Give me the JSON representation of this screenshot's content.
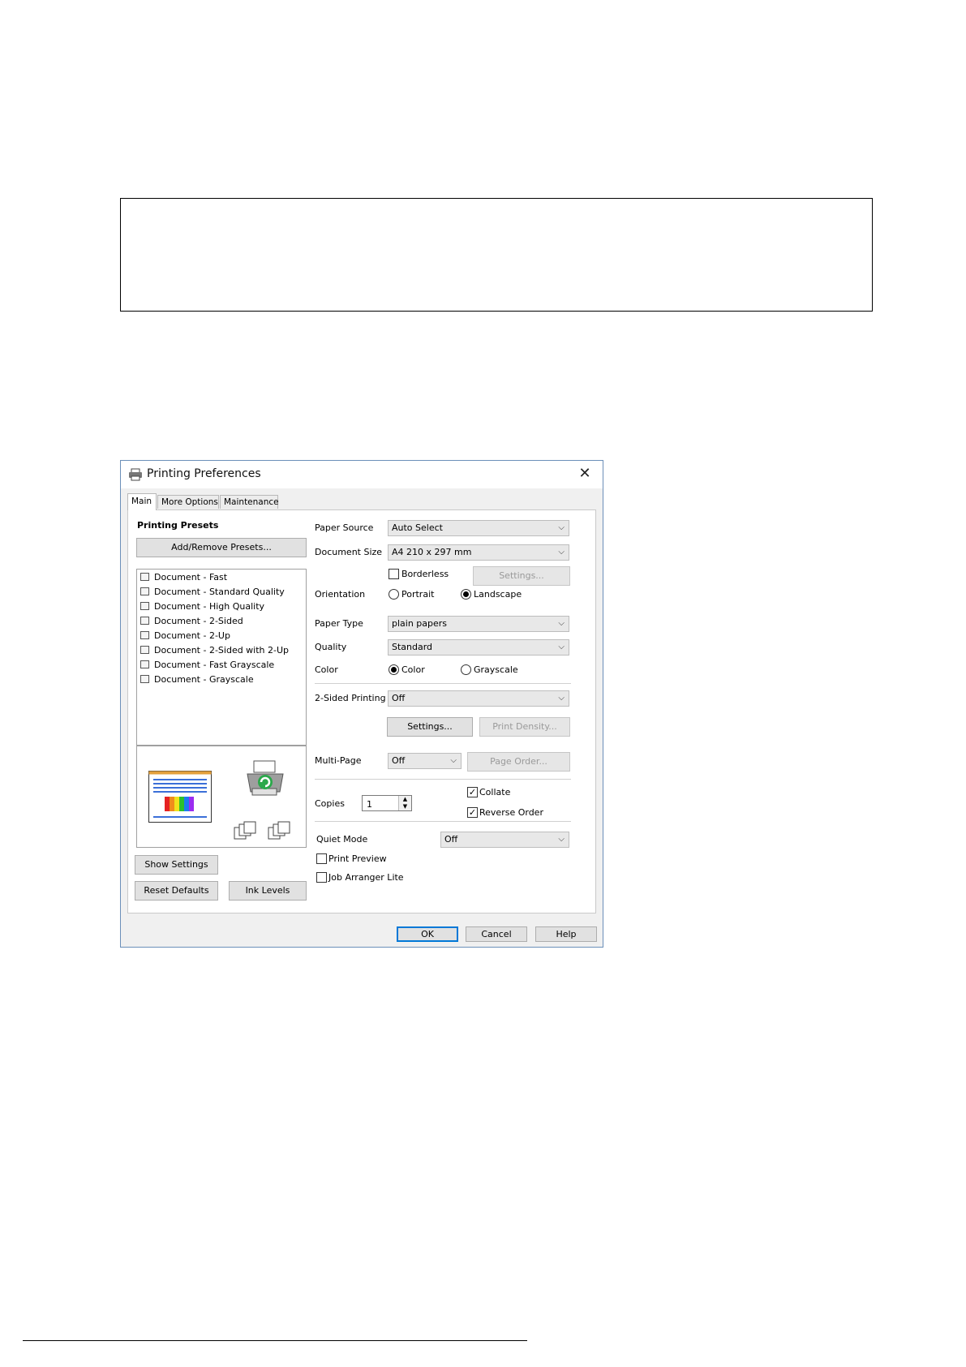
{
  "dialog": {
    "title": "Printing Preferences",
    "close": "✕",
    "tabs": [
      "Main",
      "More Options",
      "Maintenance"
    ]
  },
  "presets": {
    "heading": "Printing Presets",
    "add_remove": "Add/Remove Presets...",
    "items": [
      "Document - Fast",
      "Document - Standard Quality",
      "Document - High Quality",
      "Document - 2-Sided",
      "Document - 2-Up",
      "Document - 2-Sided with 2-Up",
      "Document - Fast Grayscale",
      "Document - Grayscale"
    ],
    "show_settings": "Show Settings",
    "reset_defaults": "Reset Defaults",
    "ink_levels": "Ink Levels"
  },
  "settings": {
    "paper_source_label": "Paper Source",
    "paper_source_value": "Auto Select",
    "document_size_label": "Document Size",
    "document_size_value": "A4 210 x 297 mm",
    "borderless": "Borderless",
    "borderless_settings": "Settings...",
    "orientation_label": "Orientation",
    "portrait": "Portrait",
    "landscape": "Landscape",
    "paper_type_label": "Paper Type",
    "paper_type_value": "plain papers",
    "quality_label": "Quality",
    "quality_value": "Standard",
    "color_label": "Color",
    "color_option": "Color",
    "grayscale_option": "Grayscale",
    "two_sided_label": "2-Sided Printing",
    "two_sided_value": "Off",
    "two_sided_settings": "Settings...",
    "print_density": "Print Density...",
    "multi_page_label": "Multi-Page",
    "multi_page_value": "Off",
    "page_order": "Page Order...",
    "copies_label": "Copies",
    "copies_value": "1",
    "collate": "Collate",
    "reverse_order": "Reverse Order",
    "quiet_mode_label": "Quiet Mode",
    "quiet_mode_value": "Off",
    "print_preview": "Print Preview",
    "job_arranger": "Job Arranger Lite"
  },
  "footer": {
    "ok": "OK",
    "cancel": "Cancel",
    "help": "Help"
  },
  "icons": {
    "chevron": "⌵",
    "check": "✓"
  }
}
